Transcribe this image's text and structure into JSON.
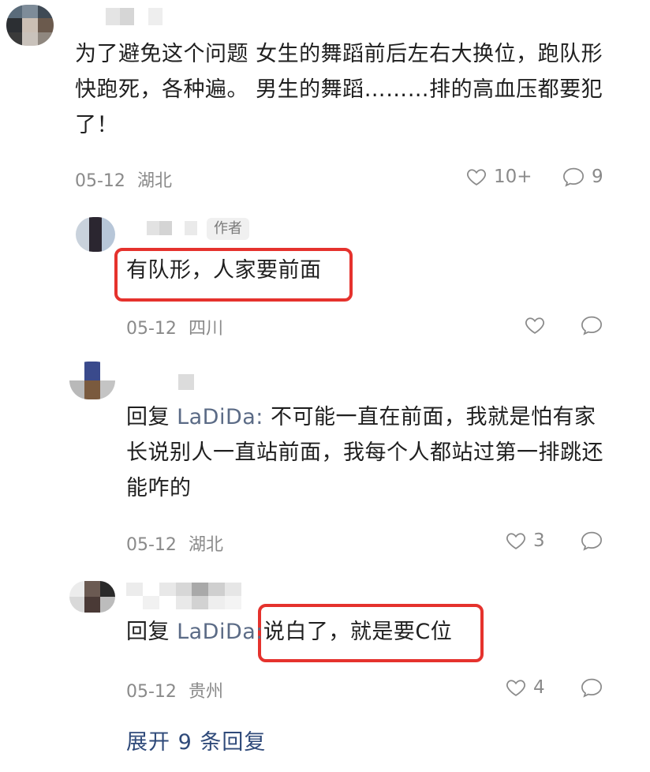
{
  "comments": [
    {
      "text": "为了避免这个问题 女生的舞蹈前后左右大换位，跑队形快跑死，各种遍。 男生的舞蹈………排的高血压都要犯了！",
      "date": "05-12",
      "location": "湖北",
      "likes": "10+",
      "replies": "9"
    }
  ],
  "replies": [
    {
      "author_tag": "作者",
      "text": "有队形，人家要前面",
      "date": "05-12",
      "location": "四川",
      "likes": ""
    },
    {
      "reply_prefix": "回复 ",
      "mention": "LaDiDa:",
      "text": " 不可能一直在前面，我就是怕有家长说别人一直站前面，我每个人都站过第一排跳还能咋的",
      "date": "05-12",
      "location": "湖北",
      "likes": "3"
    },
    {
      "reply_prefix": "回复 ",
      "mention": "LaDiDa:",
      "text": "说白了，就是要C位",
      "date": "05-12",
      "location": "贵州",
      "likes": "4"
    }
  ],
  "expand_label": "展开 9 条回复",
  "colors": {
    "highlight_box": "#e5322d",
    "mention": "#5b6b86",
    "expand_link": "#2f4a7a",
    "meta_gray": "#8a8a8a"
  },
  "icons": [
    "heart-icon",
    "comment-bubble-icon"
  ]
}
